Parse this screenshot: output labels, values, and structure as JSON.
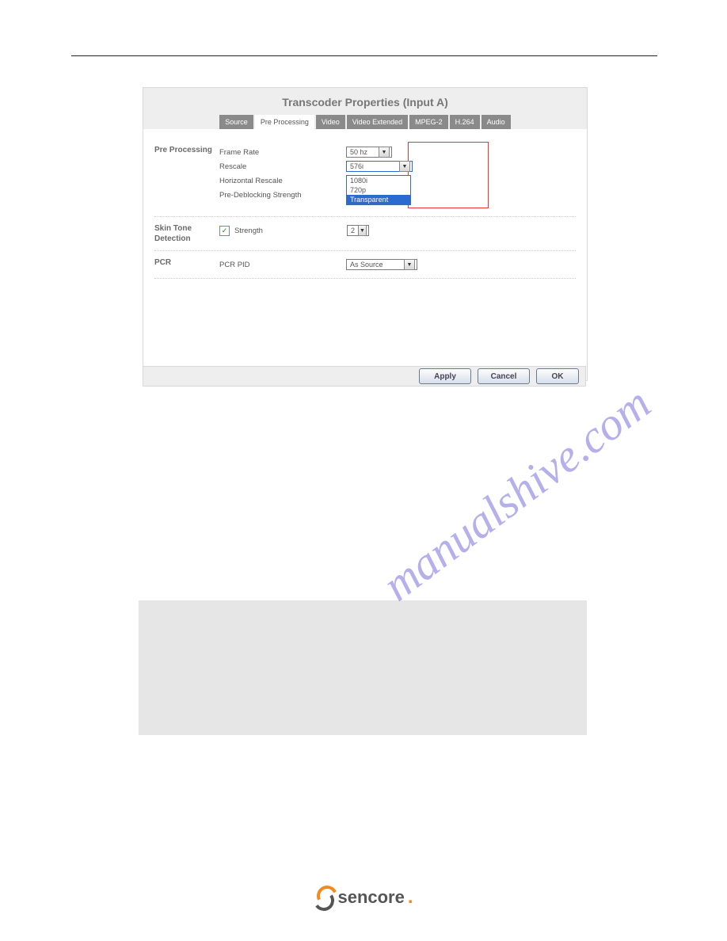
{
  "dialog": {
    "title": "Transcoder Properties (Input A)",
    "tabs": [
      "Source",
      "Pre Processing",
      "Video",
      "Video Extended",
      "MPEG-2",
      "H.264",
      "Audio"
    ],
    "active_tab": "Pre Processing"
  },
  "preprocessing": {
    "section_label": "Pre Processing",
    "frame_rate_label": "Frame Rate",
    "frame_rate_value": "50 hz",
    "rescale_label": "Rescale",
    "rescale_value": "576i",
    "rescale_options": [
      "1080i",
      "720p",
      "Transparent"
    ],
    "rescale_selected_option": "Transparent",
    "horizontal_rescale_label": "Horizontal Rescale",
    "predeblock_label": "Pre-Deblocking Strength"
  },
  "skintone": {
    "section_label": "Skin Tone Detection",
    "checkbox_checked": true,
    "strength_label": "Strength",
    "strength_value": "2"
  },
  "pcr": {
    "section_label": "PCR",
    "pcr_pid_label": "PCR PID",
    "pcr_pid_value": "As Source"
  },
  "buttons": {
    "apply": "Apply",
    "cancel": "Cancel",
    "ok": "OK"
  },
  "watermark": "manualshive.com",
  "logo_text": "sencore"
}
